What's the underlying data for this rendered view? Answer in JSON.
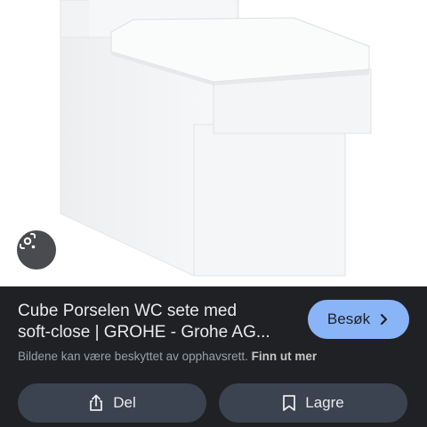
{
  "result": {
    "title_line1": "Cube Porselen WC sete med",
    "title_line2": "soft-close | GROHE - Grohe AG...",
    "visit_label": "Besøk",
    "copyright_text": "Bildene kan være beskyttet av opphavsrett.",
    "learn_more_label": "Finn ut mer"
  },
  "actions": {
    "share_label": "Del",
    "save_label": "Lagre"
  },
  "icons": {
    "lens": "lens-search-icon",
    "visit": "chevron-right-icon",
    "share": "share-icon",
    "save": "bookmark-icon"
  },
  "colors": {
    "panel_background": "#202124",
    "visit_button": "#8ab4f8",
    "action_button": "#3c4350"
  }
}
